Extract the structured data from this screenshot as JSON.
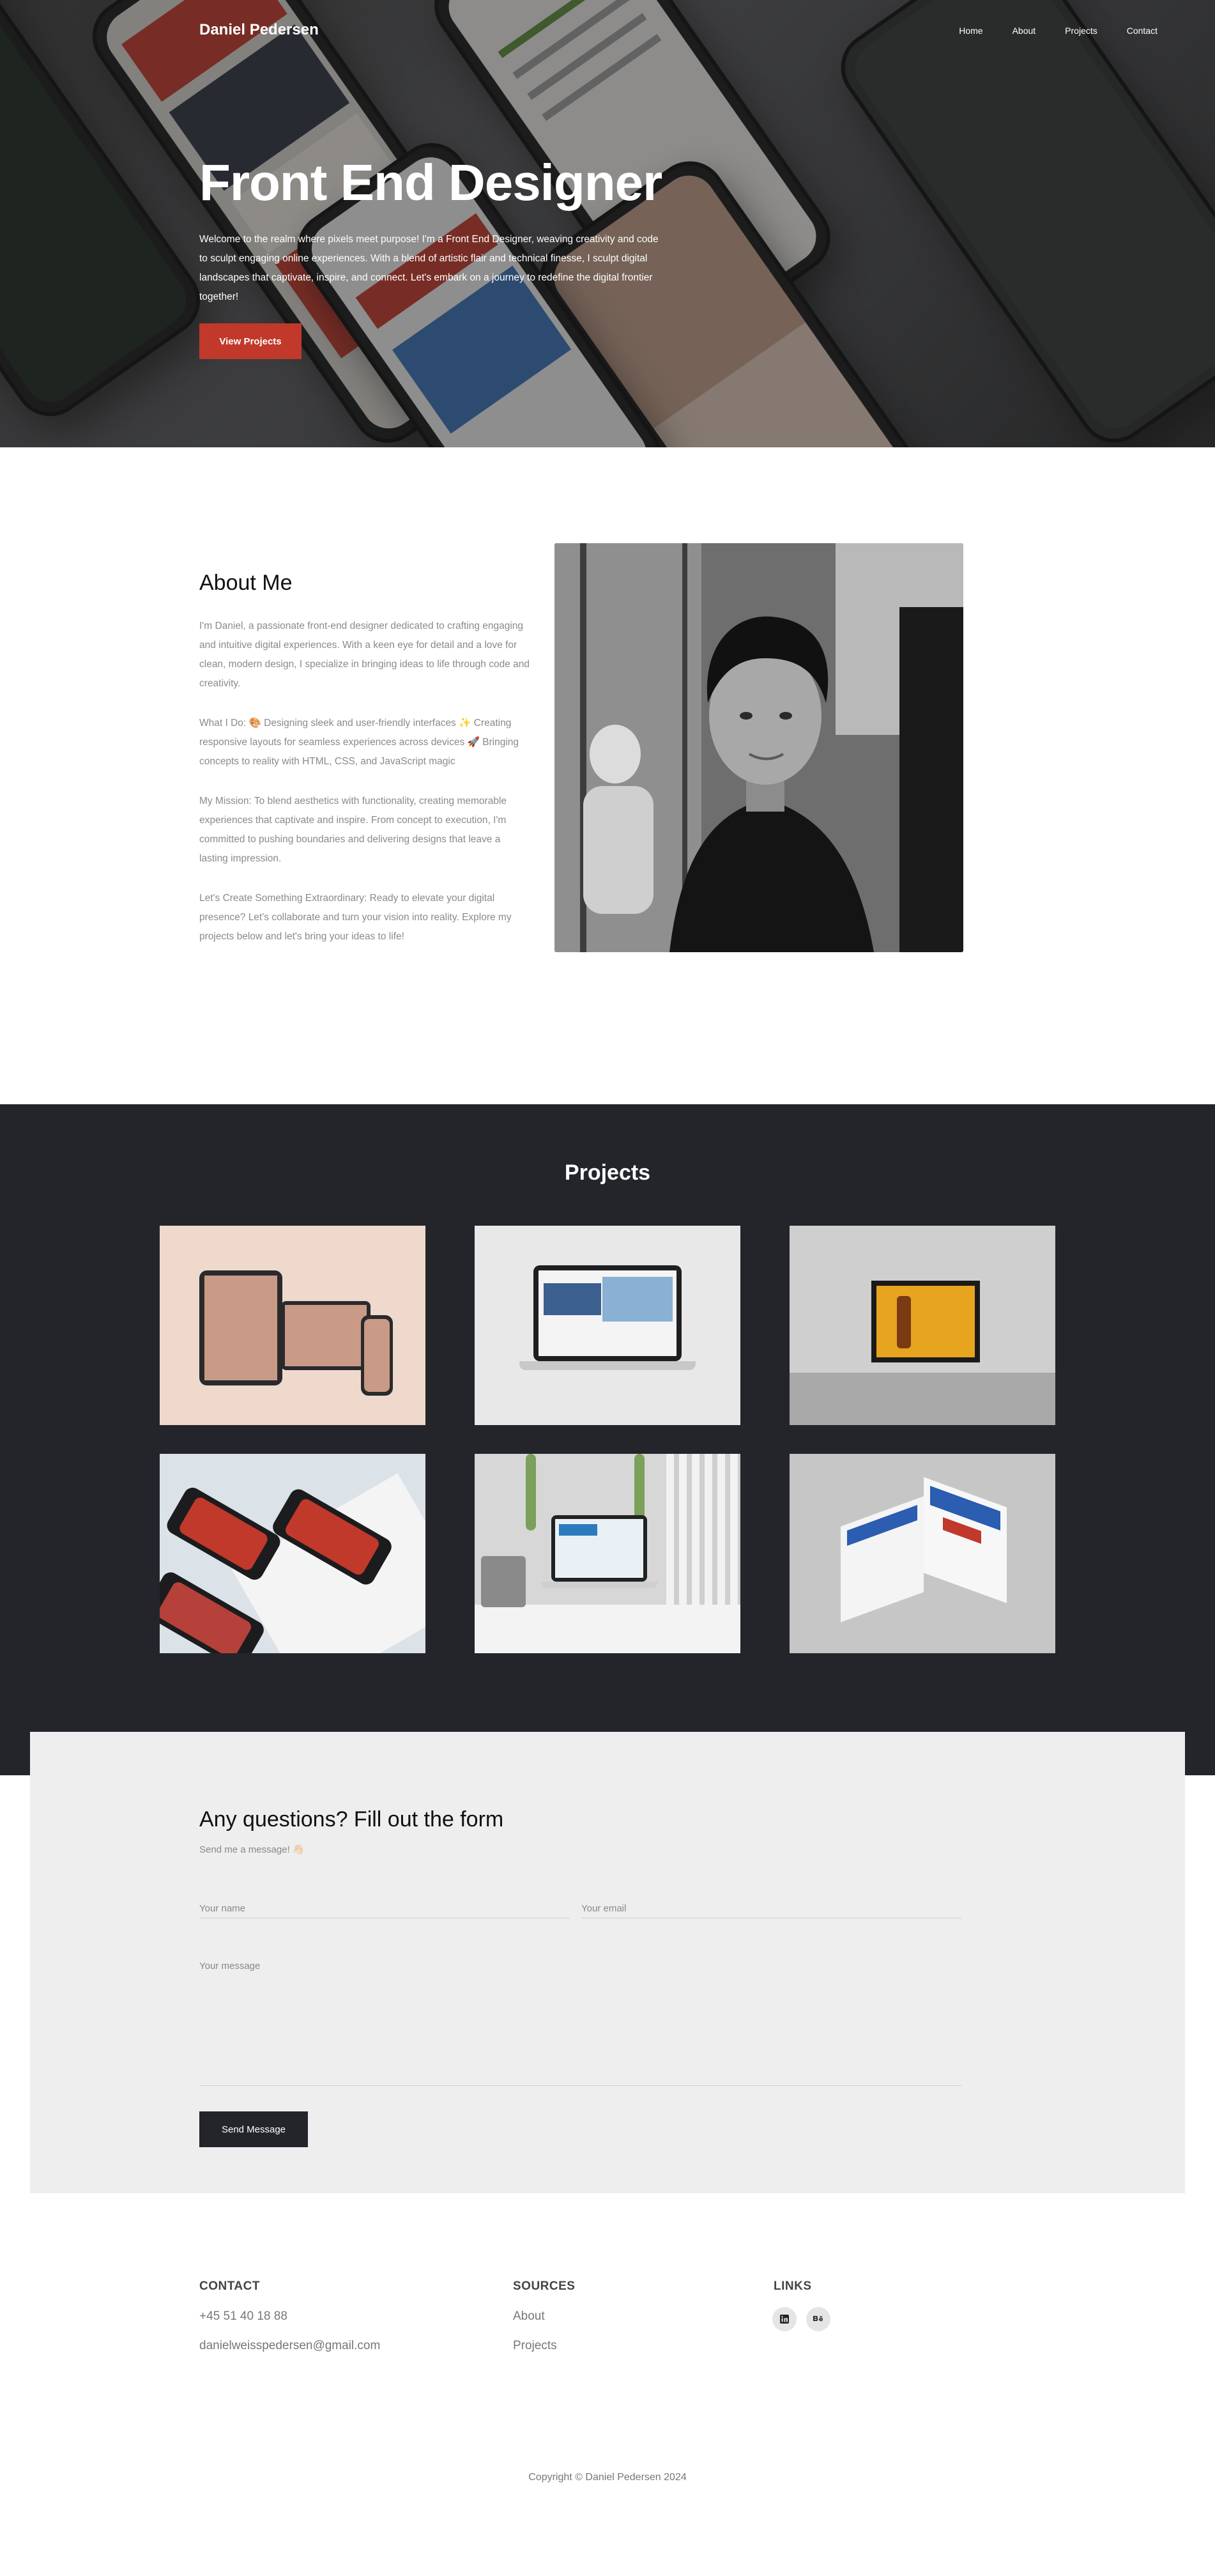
{
  "header": {
    "brand": "Daniel Pedersen",
    "nav": [
      "Home",
      "About",
      "Projects",
      "Contact"
    ]
  },
  "hero": {
    "title": "Front End Designer",
    "text": "Welcome to the realm where pixels meet purpose! I'm a Front End Designer, weaving creativity and code to sculpt engaging online experiences. With a blend of artistic flair and technical finesse, I sculpt digital landscapes that captivate, inspire, and connect. Let's embark on a journey to redefine the digital frontier together!",
    "button": "View Projects"
  },
  "about": {
    "title": "About Me",
    "paragraphs": [
      "I'm Daniel, a passionate front-end designer dedicated to crafting engaging and intuitive digital experiences. With a keen eye for detail and a love for clean, modern design, I specialize in bringing ideas to life through code and creativity.",
      "What I Do: 🎨 Designing sleek and user-friendly interfaces ✨ Creating responsive layouts for seamless experiences across devices 🚀 Bringing concepts to reality with HTML, CSS, and JavaScript magic",
      "My Mission: To blend aesthetics with functionality, creating memorable experiences that captivate and inspire. From concept to execution, I'm committed to pushing boundaries and delivering designs that leave a lasting impression.",
      "Let's Create Something Extraordinary: Ready to elevate your digital presence? Let's collaborate and turn your vision into reality. Explore my projects below and let's bring your ideas to life!"
    ]
  },
  "projects": {
    "title": "Projects"
  },
  "contact_form": {
    "title": "Any questions? Fill out the form",
    "subtitle": "Send me a message! 👋🏻",
    "name_placeholder": "Your name",
    "email_placeholder": "Your email",
    "message_placeholder": "Your message",
    "button": "Send Message"
  },
  "footer": {
    "contact": {
      "heading": "CONTACT",
      "phone": "+45 51 40 18 88",
      "email": "danielweisspedersen@gmail.com"
    },
    "sources": {
      "heading": "SOURCES",
      "items": [
        "About",
        "Projects"
      ]
    },
    "links": {
      "heading": "LINKS",
      "icons": [
        "linkedin-icon",
        "behance-icon"
      ]
    },
    "copyright": "Copyright © Daniel Pedersen 2024"
  },
  "colors": {
    "accent": "#c0392b",
    "dark": "#23252b",
    "form_bg": "#eeeeee"
  }
}
